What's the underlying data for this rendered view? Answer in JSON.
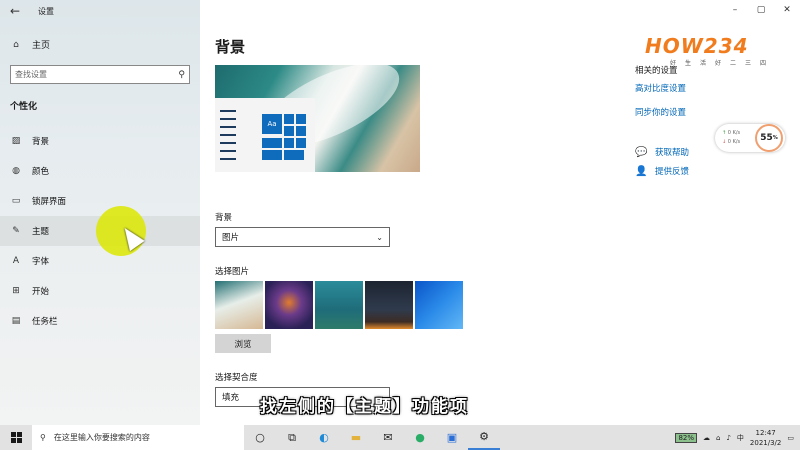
{
  "window": {
    "app_title": "设置",
    "controls": {
      "minimize": "–",
      "maximize": "▢",
      "close": "✕"
    }
  },
  "sidebar": {
    "home_label": "主页",
    "search_placeholder": "查找设置",
    "section_title": "个性化",
    "items": [
      {
        "label": "背景",
        "icon": "picture-icon"
      },
      {
        "label": "颜色",
        "icon": "palette-icon"
      },
      {
        "label": "锁屏界面",
        "icon": "lockscreen-icon"
      },
      {
        "label": "主题",
        "icon": "brush-icon"
      },
      {
        "label": "字体",
        "icon": "font-icon"
      },
      {
        "label": "开始",
        "icon": "start-icon"
      },
      {
        "label": "任务栏",
        "icon": "taskbar-icon"
      }
    ],
    "hovered_item": "主题"
  },
  "main": {
    "title": "背景",
    "preview_tile_text": "Aa",
    "background_label": "背景",
    "background_value": "图片",
    "choose_picture_label": "选择图片",
    "browse_label": "浏览",
    "fit_label": "选择契合度",
    "fit_value": "填充",
    "related": {
      "title": "相关的设置",
      "links": [
        "高对比度设置",
        "同步你的设置"
      ],
      "help": "获取帮助",
      "feedback": "提供反馈"
    }
  },
  "overlay": {
    "subtitle": "找左侧的【主题】功能项",
    "logo_text": "HOW234",
    "logo_sub": "好生活好二三四",
    "speed": {
      "up": "0 K/s",
      "down": "0 K/s",
      "percent": "55",
      "unit": "%"
    }
  },
  "taskbar": {
    "search_placeholder": "在这里输入你要搜索的内容",
    "battery": "82%",
    "ime": "中",
    "time": "12:47",
    "date": "2021/3/2"
  },
  "colors": {
    "accent": "#0f6cbd",
    "link": "#0067b8",
    "cursor_highlight": "#dce800",
    "logo": "#f07c1e"
  }
}
